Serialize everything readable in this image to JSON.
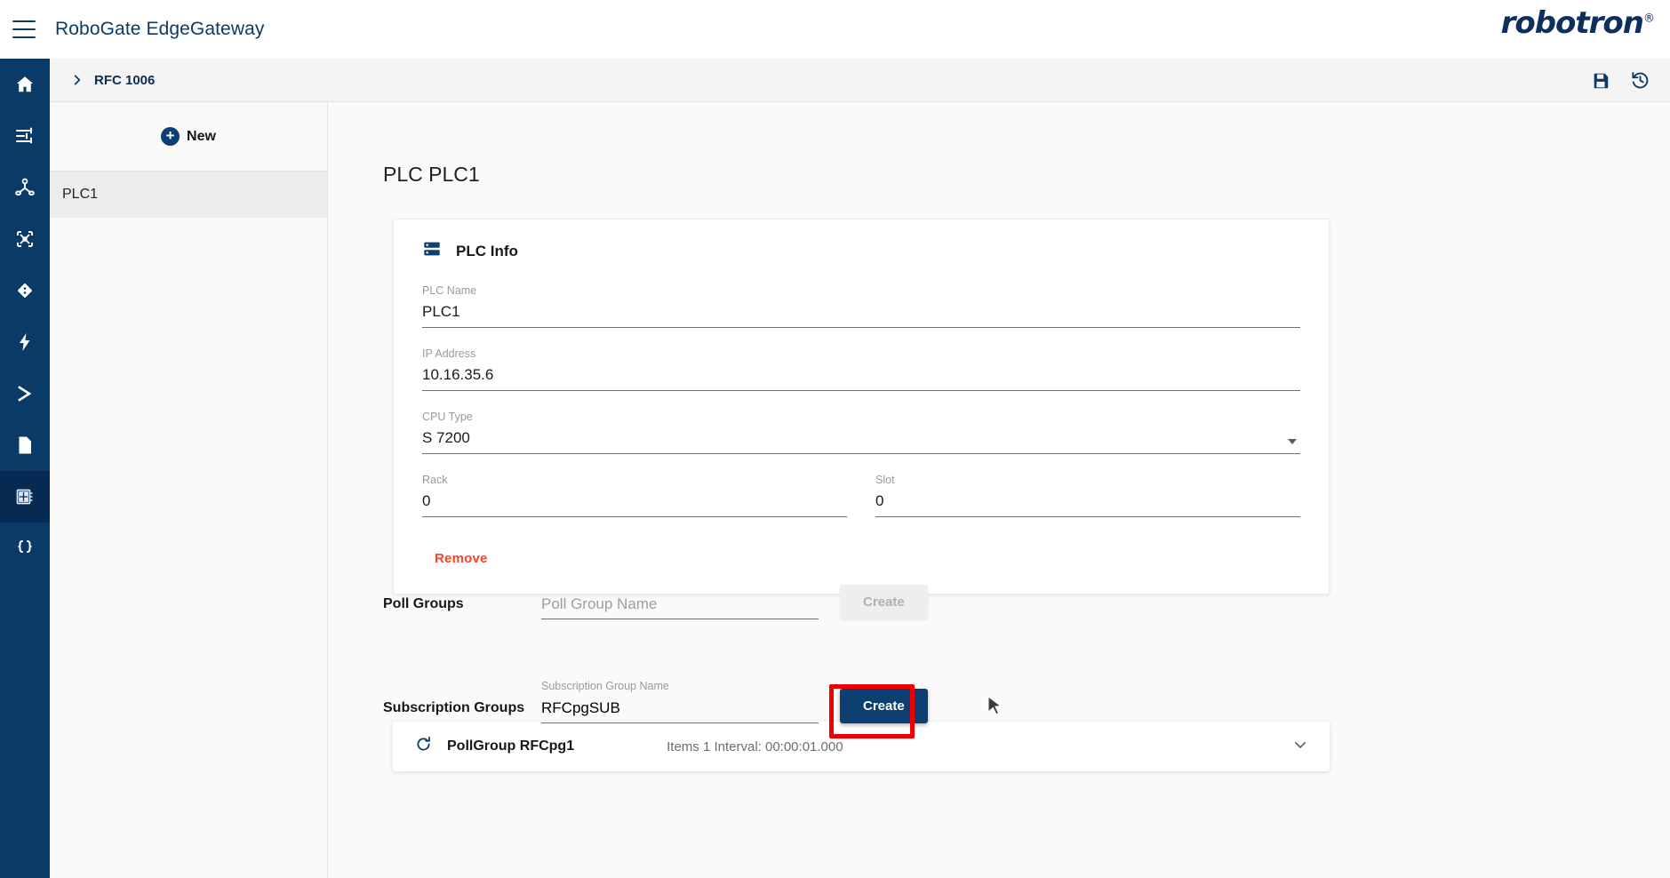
{
  "header": {
    "menu_icon": "hamburger-icon",
    "app_title": "RoboGate EdgeGateway",
    "brand": "robotron",
    "brand_mark": "®"
  },
  "sidebar": {
    "items": [
      {
        "icon": "home-icon",
        "active": false
      },
      {
        "icon": "sliders-icon",
        "active": false
      },
      {
        "icon": "hub-icon",
        "active": false
      },
      {
        "icon": "network-nodes-icon",
        "active": false
      },
      {
        "icon": "diamond-icon",
        "active": false
      },
      {
        "icon": "lightning-icon",
        "active": false
      },
      {
        "icon": "chevron-right-icon",
        "active": false
      },
      {
        "icon": "document-icon",
        "active": false
      },
      {
        "icon": "chip-icon",
        "active": true
      },
      {
        "icon": "braces-icon",
        "active": false
      }
    ]
  },
  "breadcrumb": {
    "chevron_icon": "chevron-right-icon",
    "text": "RFC 1006",
    "save_icon": "save-icon",
    "history_icon": "restore-icon"
  },
  "list_panel": {
    "new_label": "New",
    "new_icon": "plus-circle-icon",
    "entries": [
      {
        "label": "PLC1",
        "selected": true
      }
    ]
  },
  "main": {
    "page_title": "PLC PLC1",
    "plc_info": {
      "icon": "server-rack-icon",
      "title": "PLC Info",
      "fields": [
        {
          "label": "PLC Name",
          "value": "PLC1",
          "type": "text"
        },
        {
          "label": "IP Address",
          "value": "10.16.35.6",
          "type": "text"
        },
        {
          "label": "CPU Type",
          "value": "S 7200",
          "type": "select"
        }
      ],
      "rack": {
        "label": "Rack",
        "value": "0"
      },
      "slot": {
        "label": "Slot",
        "value": "0"
      },
      "remove_label": "Remove",
      "remove_color": "#f4442e"
    },
    "poll_groups": {
      "section_label": "Poll Groups",
      "name_placeholder": "Poll Group Name",
      "name_value": "",
      "create_label": "Create",
      "create_disabled": true,
      "group": {
        "icon": "refresh-icon",
        "name": "PollGroup RFCpg1",
        "meta": "Items 1  Interval: 00:00:01.000",
        "chevron_icon": "chevron-down-icon"
      }
    },
    "subscription_groups": {
      "section_label": "Subscription Groups",
      "name_label": "Subscription Group Name",
      "name_value": "RFCpgSUB",
      "create_label": "Create",
      "create_highlighted": true,
      "highlight_color": "#ee0000"
    }
  },
  "colors": {
    "brand_navy": "#0a3a68",
    "sidebar_active": "#062a52",
    "primary_button": "#0d3f73",
    "danger": "#f4442e"
  }
}
